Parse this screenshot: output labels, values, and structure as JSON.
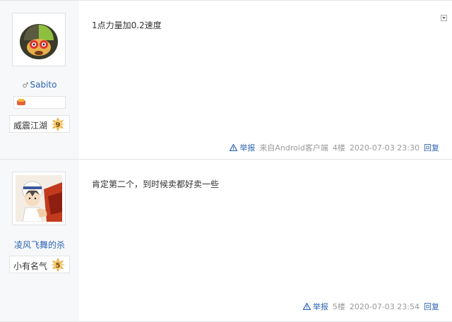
{
  "posts": [
    {
      "username": "Sabito",
      "level_title": "威震江湖",
      "level": "9",
      "content": "1点力量加0.2速度",
      "report_label": "举报",
      "source": "来自Android客户端",
      "floor": "4楼",
      "time": "2020-07-03 23:30",
      "reply_label": "回复"
    },
    {
      "username": "凌风飞舞的杀",
      "level_title": "小有名气",
      "level": "5",
      "content": "肯定第二个，到时候卖都好卖一些",
      "report_label": "举报",
      "floor": "5楼",
      "time": "2020-07-03 23:54",
      "reply_label": "回复"
    }
  ],
  "colors": {
    "link": "#2d64b3",
    "sidebar_bg": "#f7f8fa",
    "meta_text": "#999999",
    "badge_gold": "#e8b04a"
  },
  "icons": [
    "male-icon",
    "medal-icon",
    "level-badge-icon",
    "warning-icon",
    "dropdown-icon"
  ]
}
